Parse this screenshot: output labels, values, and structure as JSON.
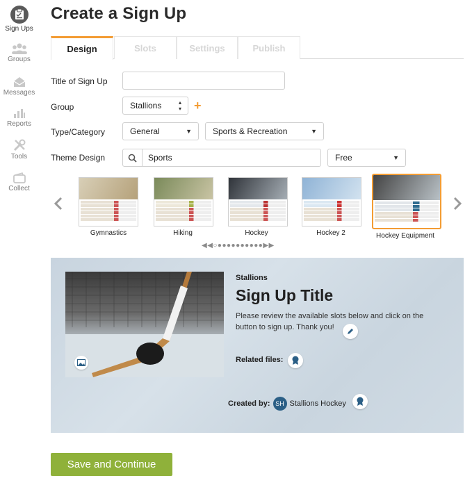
{
  "sidebar": {
    "items": [
      {
        "label": "Sign Ups",
        "icon": "clipboard-icon",
        "active": true
      },
      {
        "label": "Groups",
        "icon": "people-icon"
      },
      {
        "label": "Messages",
        "icon": "envelope-icon"
      },
      {
        "label": "Reports",
        "icon": "bar-chart-icon"
      },
      {
        "label": "Tools",
        "icon": "tools-icon"
      },
      {
        "label": "Collect",
        "icon": "wallet-icon"
      }
    ]
  },
  "page": {
    "title": "Create a Sign Up"
  },
  "tabs": [
    {
      "label": "Design",
      "active": true
    },
    {
      "label": "Slots"
    },
    {
      "label": "Settings"
    },
    {
      "label": "Publish"
    }
  ],
  "form": {
    "title_label": "Title of Sign Up",
    "title_value": "",
    "group_label": "Group",
    "group_value": "Stallions",
    "type_label": "Type/Category",
    "type_value": "General",
    "category_value": "Sports & Recreation",
    "theme_label": "Theme Design",
    "theme_search_value": "Sports",
    "price_filter_value": "Free"
  },
  "themes": [
    {
      "label": "Gymnastics"
    },
    {
      "label": "Hiking"
    },
    {
      "label": "Hockey"
    },
    {
      "label": "Hockey 2"
    },
    {
      "label": "Hockey Equipment",
      "selected": true
    }
  ],
  "preview": {
    "group": "Stallions",
    "title": "Sign Up Title",
    "description": "Please review the available slots below and click on the button to sign up. Thank you!",
    "related_files_label": "Related files:",
    "created_by_label": "Created by:",
    "creator_initials": "SH",
    "creator_name": "Stallions Hockey"
  },
  "actions": {
    "save_label": "Save and Continue"
  },
  "colors": {
    "accent": "#f39c33",
    "save_button": "#8fb13a",
    "avatar": "#2b5f86"
  }
}
